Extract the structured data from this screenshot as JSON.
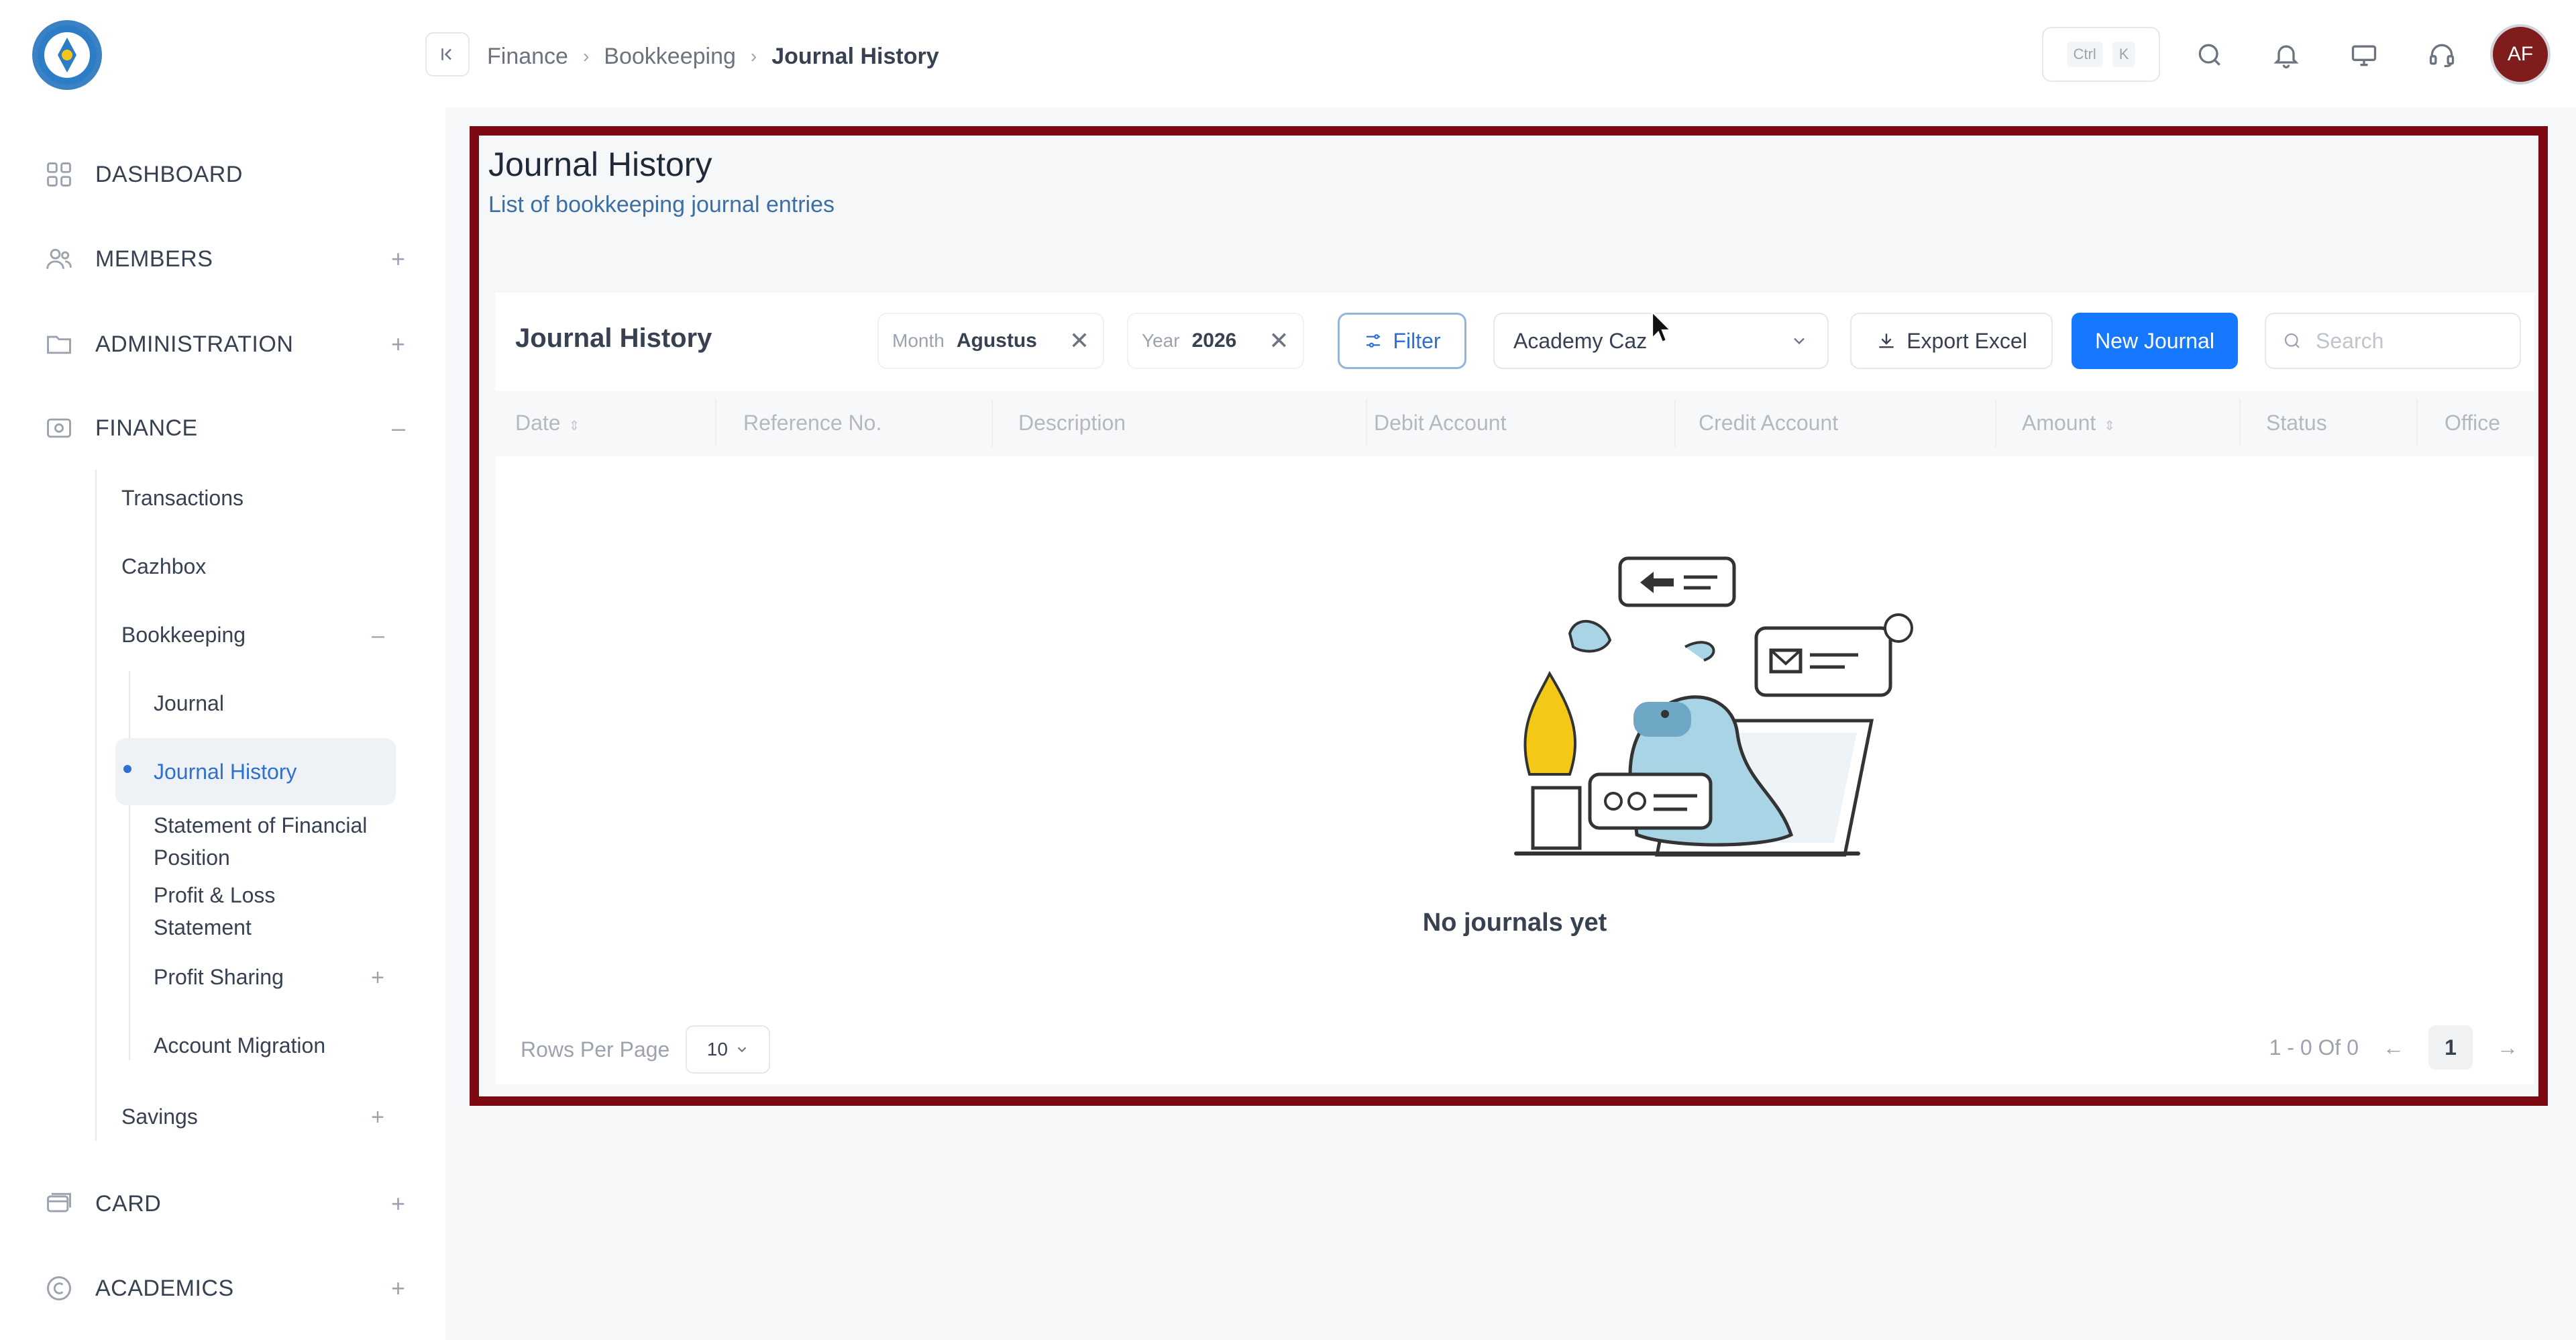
{
  "sidebar": {
    "sections": [
      {
        "label": "DASHBOARD",
        "icon": "grid-icon",
        "toggle": ""
      },
      {
        "label": "MEMBERS",
        "icon": "users-icon",
        "toggle": "+"
      },
      {
        "label": "ADMINISTRATION",
        "icon": "folder-icon",
        "toggle": "+"
      },
      {
        "label": "FINANCE",
        "icon": "wallet-icon",
        "toggle": "–"
      },
      {
        "label": "CARD",
        "icon": "card-icon",
        "toggle": "+"
      },
      {
        "label": "ACADEMICS",
        "icon": "academics-icon",
        "toggle": "+"
      }
    ],
    "finance_items": [
      {
        "label": "Transactions"
      },
      {
        "label": "Cazhbox"
      },
      {
        "label": "Bookkeeping",
        "toggle": "–"
      },
      {
        "label": "Savings",
        "toggle": "+"
      }
    ],
    "bookkeeping_items": [
      {
        "label": "Journal"
      },
      {
        "label": "Journal History"
      },
      {
        "label_line1": "Statement of Financial",
        "label_line2": "Position"
      },
      {
        "label_line1": "Profit & Loss",
        "label_line2": "Statement"
      },
      {
        "label": "Profit Sharing",
        "toggle": "+"
      },
      {
        "label": "Account Migration"
      }
    ]
  },
  "header": {
    "breadcrumb": [
      "Finance",
      "Bookkeeping",
      "Journal History"
    ],
    "shortcut_keys": [
      "Ctrl",
      "K"
    ],
    "avatar_initials": "AF",
    "icons": [
      "search-icon",
      "bell-icon",
      "monitor-icon",
      "headset-icon"
    ]
  },
  "page": {
    "title": "Journal History",
    "subtitle": "List of bookkeeping journal entries"
  },
  "card": {
    "title": "Journal History",
    "month_filter": {
      "key": "Month",
      "value": "Agustus"
    },
    "year_filter": {
      "key": "Year",
      "value": "2026"
    },
    "filter_label": "Filter",
    "office_value": "Academy Caz",
    "export_label": "Export Excel",
    "new_label": "New Journal",
    "search_placeholder": "Search",
    "columns": [
      "Date",
      "Reference No.",
      "Description",
      "Debit Account",
      "Credit Account",
      "Amount",
      "Status",
      "Office"
    ],
    "empty_message": "No journals yet",
    "rows_per_page_label": "Rows Per Page",
    "rows_per_page_value": "10",
    "range_text": "1 - 0 Of 0",
    "current_page": "1"
  },
  "colors": {
    "accent": "#1677ff",
    "highlight_border": "#7d0a12",
    "active_nav": "#2f6fd1",
    "avatar": "#7f1d1d"
  }
}
